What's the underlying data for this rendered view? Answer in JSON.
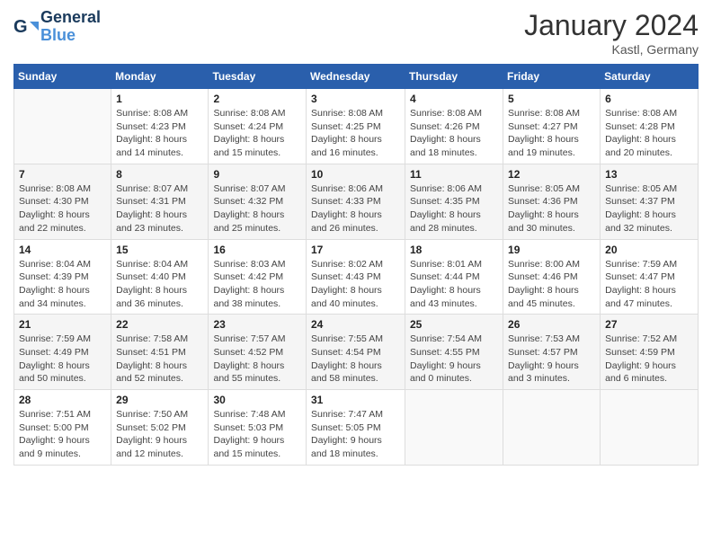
{
  "header": {
    "logo_line1": "General",
    "logo_line2": "Blue",
    "month": "January 2024",
    "location": "Kastl, Germany"
  },
  "weekdays": [
    "Sunday",
    "Monday",
    "Tuesday",
    "Wednesday",
    "Thursday",
    "Friday",
    "Saturday"
  ],
  "weeks": [
    [
      {
        "day": "",
        "info": ""
      },
      {
        "day": "1",
        "info": "Sunrise: 8:08 AM\nSunset: 4:23 PM\nDaylight: 8 hours\nand 14 minutes."
      },
      {
        "day": "2",
        "info": "Sunrise: 8:08 AM\nSunset: 4:24 PM\nDaylight: 8 hours\nand 15 minutes."
      },
      {
        "day": "3",
        "info": "Sunrise: 8:08 AM\nSunset: 4:25 PM\nDaylight: 8 hours\nand 16 minutes."
      },
      {
        "day": "4",
        "info": "Sunrise: 8:08 AM\nSunset: 4:26 PM\nDaylight: 8 hours\nand 18 minutes."
      },
      {
        "day": "5",
        "info": "Sunrise: 8:08 AM\nSunset: 4:27 PM\nDaylight: 8 hours\nand 19 minutes."
      },
      {
        "day": "6",
        "info": "Sunrise: 8:08 AM\nSunset: 4:28 PM\nDaylight: 8 hours\nand 20 minutes."
      }
    ],
    [
      {
        "day": "7",
        "info": "Sunrise: 8:08 AM\nSunset: 4:30 PM\nDaylight: 8 hours\nand 22 minutes."
      },
      {
        "day": "8",
        "info": "Sunrise: 8:07 AM\nSunset: 4:31 PM\nDaylight: 8 hours\nand 23 minutes."
      },
      {
        "day": "9",
        "info": "Sunrise: 8:07 AM\nSunset: 4:32 PM\nDaylight: 8 hours\nand 25 minutes."
      },
      {
        "day": "10",
        "info": "Sunrise: 8:06 AM\nSunset: 4:33 PM\nDaylight: 8 hours\nand 26 minutes."
      },
      {
        "day": "11",
        "info": "Sunrise: 8:06 AM\nSunset: 4:35 PM\nDaylight: 8 hours\nand 28 minutes."
      },
      {
        "day": "12",
        "info": "Sunrise: 8:05 AM\nSunset: 4:36 PM\nDaylight: 8 hours\nand 30 minutes."
      },
      {
        "day": "13",
        "info": "Sunrise: 8:05 AM\nSunset: 4:37 PM\nDaylight: 8 hours\nand 32 minutes."
      }
    ],
    [
      {
        "day": "14",
        "info": "Sunrise: 8:04 AM\nSunset: 4:39 PM\nDaylight: 8 hours\nand 34 minutes."
      },
      {
        "day": "15",
        "info": "Sunrise: 8:04 AM\nSunset: 4:40 PM\nDaylight: 8 hours\nand 36 minutes."
      },
      {
        "day": "16",
        "info": "Sunrise: 8:03 AM\nSunset: 4:42 PM\nDaylight: 8 hours\nand 38 minutes."
      },
      {
        "day": "17",
        "info": "Sunrise: 8:02 AM\nSunset: 4:43 PM\nDaylight: 8 hours\nand 40 minutes."
      },
      {
        "day": "18",
        "info": "Sunrise: 8:01 AM\nSunset: 4:44 PM\nDaylight: 8 hours\nand 43 minutes."
      },
      {
        "day": "19",
        "info": "Sunrise: 8:00 AM\nSunset: 4:46 PM\nDaylight: 8 hours\nand 45 minutes."
      },
      {
        "day": "20",
        "info": "Sunrise: 7:59 AM\nSunset: 4:47 PM\nDaylight: 8 hours\nand 47 minutes."
      }
    ],
    [
      {
        "day": "21",
        "info": "Sunrise: 7:59 AM\nSunset: 4:49 PM\nDaylight: 8 hours\nand 50 minutes."
      },
      {
        "day": "22",
        "info": "Sunrise: 7:58 AM\nSunset: 4:51 PM\nDaylight: 8 hours\nand 52 minutes."
      },
      {
        "day": "23",
        "info": "Sunrise: 7:57 AM\nSunset: 4:52 PM\nDaylight: 8 hours\nand 55 minutes."
      },
      {
        "day": "24",
        "info": "Sunrise: 7:55 AM\nSunset: 4:54 PM\nDaylight: 8 hours\nand 58 minutes."
      },
      {
        "day": "25",
        "info": "Sunrise: 7:54 AM\nSunset: 4:55 PM\nDaylight: 9 hours\nand 0 minutes."
      },
      {
        "day": "26",
        "info": "Sunrise: 7:53 AM\nSunset: 4:57 PM\nDaylight: 9 hours\nand 3 minutes."
      },
      {
        "day": "27",
        "info": "Sunrise: 7:52 AM\nSunset: 4:59 PM\nDaylight: 9 hours\nand 6 minutes."
      }
    ],
    [
      {
        "day": "28",
        "info": "Sunrise: 7:51 AM\nSunset: 5:00 PM\nDaylight: 9 hours\nand 9 minutes."
      },
      {
        "day": "29",
        "info": "Sunrise: 7:50 AM\nSunset: 5:02 PM\nDaylight: 9 hours\nand 12 minutes."
      },
      {
        "day": "30",
        "info": "Sunrise: 7:48 AM\nSunset: 5:03 PM\nDaylight: 9 hours\nand 15 minutes."
      },
      {
        "day": "31",
        "info": "Sunrise: 7:47 AM\nSunset: 5:05 PM\nDaylight: 9 hours\nand 18 minutes."
      },
      {
        "day": "",
        "info": ""
      },
      {
        "day": "",
        "info": ""
      },
      {
        "day": "",
        "info": ""
      }
    ]
  ]
}
